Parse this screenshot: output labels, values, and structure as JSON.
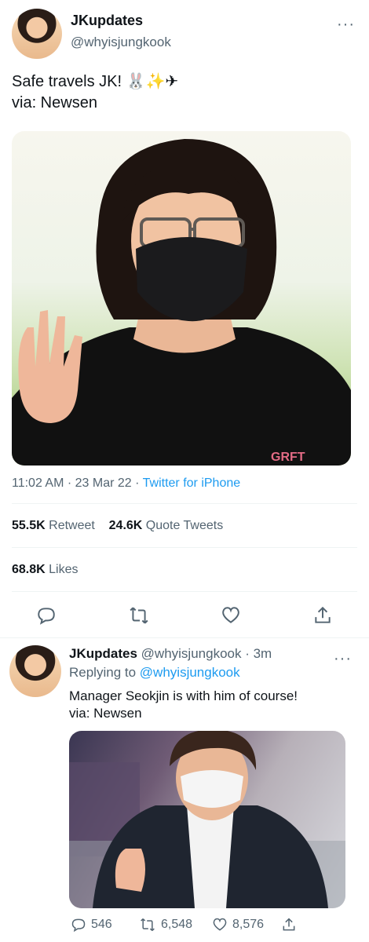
{
  "tweet": {
    "display_name": "JKupdates",
    "handle": "@whyisjungkook",
    "more": "···",
    "text": "Safe travels JK! 🐰✨✈\nvia: Newsen",
    "photo_print": "GRFT",
    "time": "11:02 AM",
    "sep": "·",
    "date": "23 Mar 22",
    "source": "Twitter for iPhone",
    "retweets_count": "55.5K",
    "retweets_label": "Retweet",
    "quotes_count": "24.6K",
    "quotes_label": "Quote Tweets",
    "likes_count": "68.8K",
    "likes_label": "Likes"
  },
  "reply": {
    "display_name": "JKupdates",
    "handle": "@whyisjungkook",
    "age": "· 3m",
    "more": "···",
    "replying_prefix": "Replying to",
    "replying_handle": "@whyisjungkook",
    "text": "Manager Seokjin is with him of course!\nvia: Newsen",
    "reply_count": "546",
    "retweet_count": "6,548",
    "like_count": "8,576"
  },
  "colors": {
    "link": "#1d9bf0",
    "muted": "#536471",
    "text": "#0f1419"
  },
  "icons": [
    "reply-icon",
    "retweet-icon",
    "like-icon",
    "share-icon",
    "more-icon"
  ]
}
